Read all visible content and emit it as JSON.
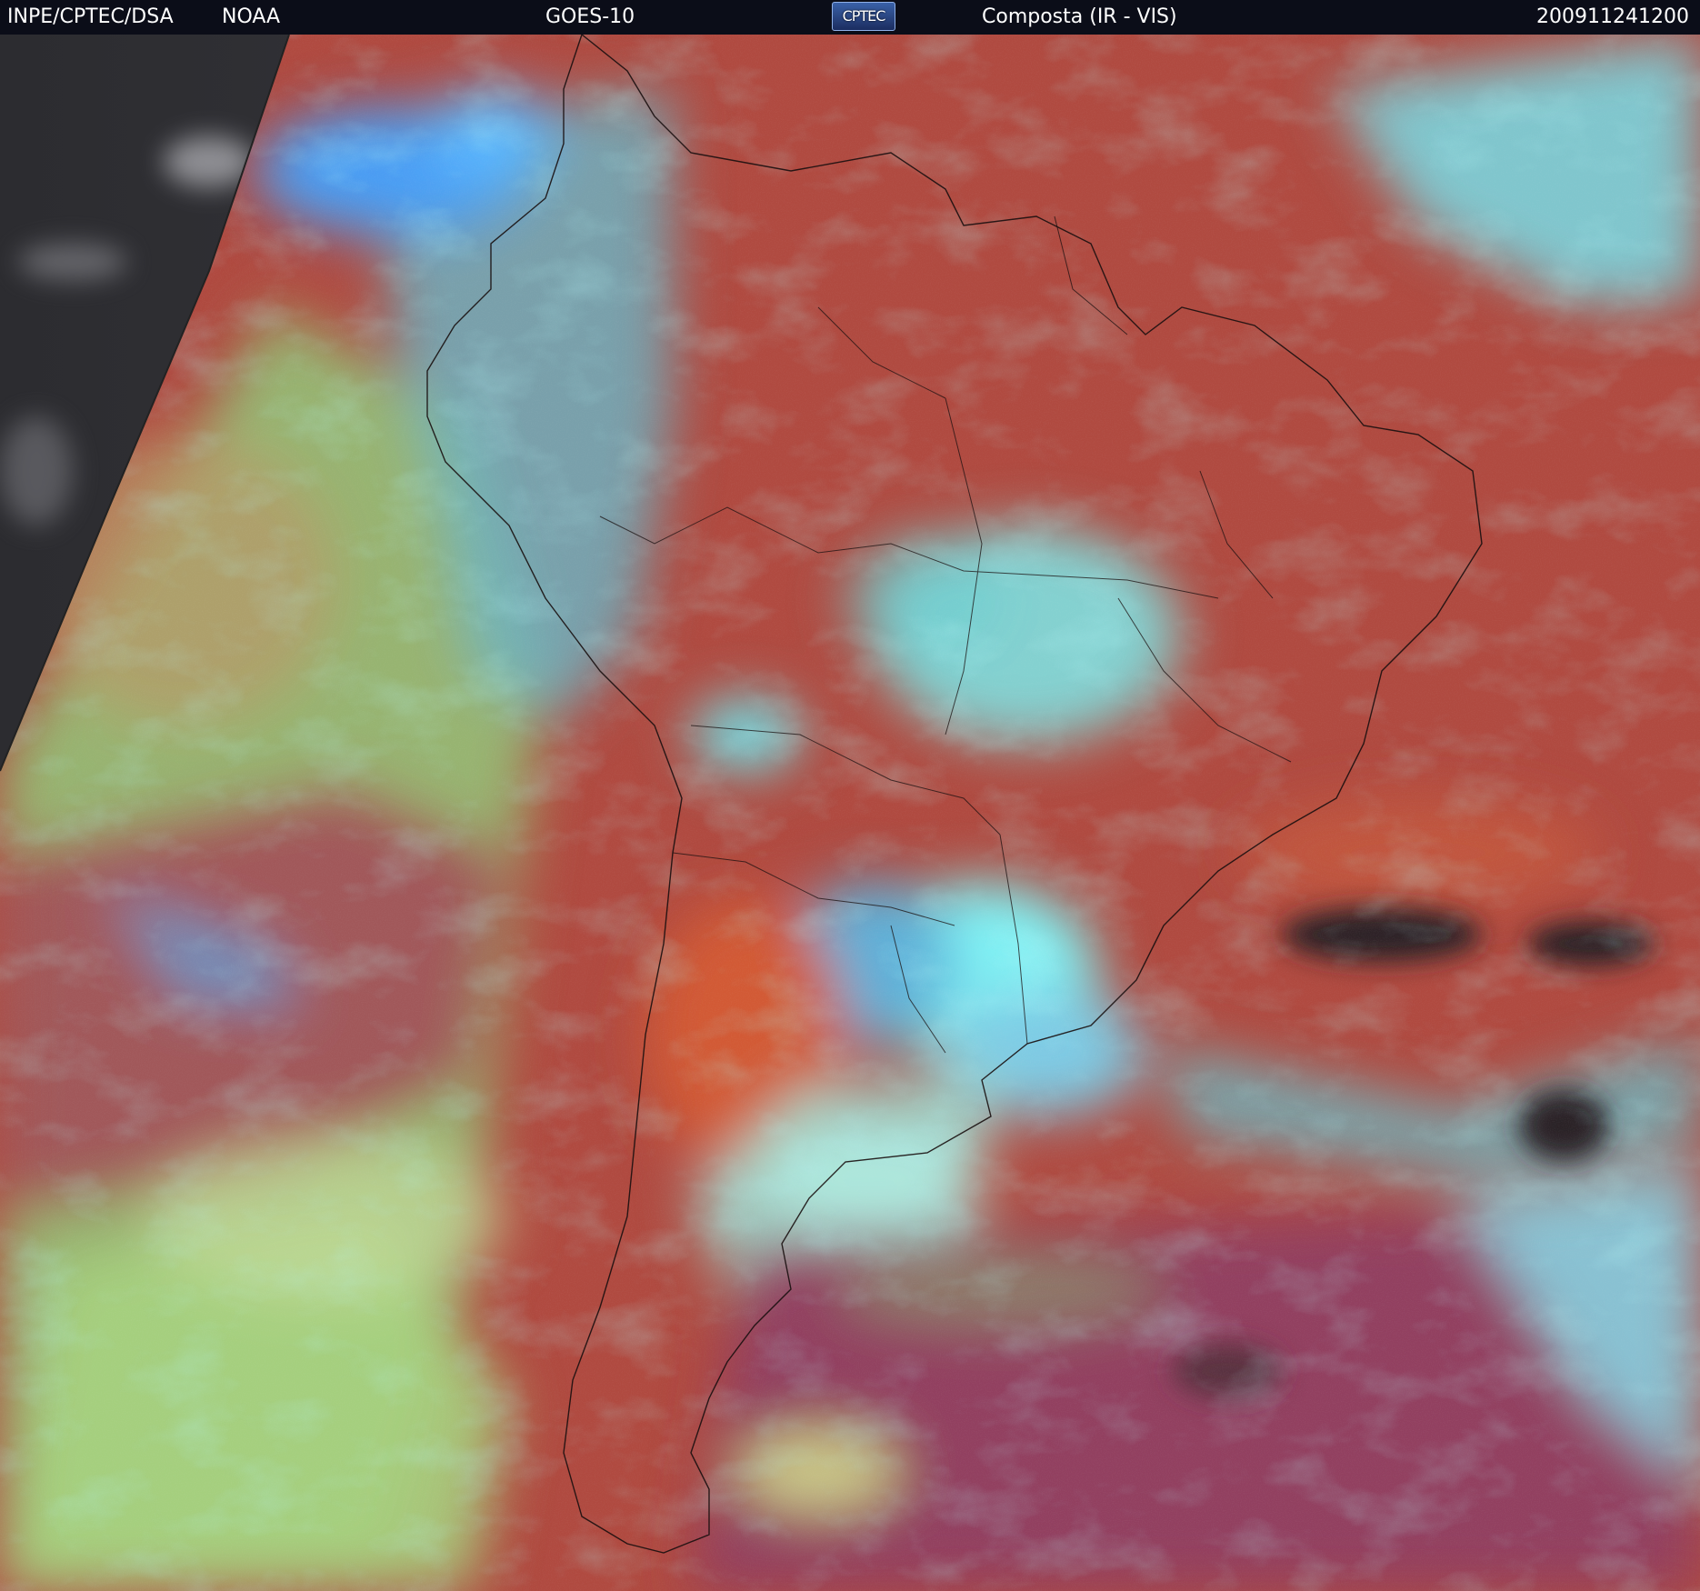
{
  "header": {
    "agency": "INPE/CPTEC/DSA",
    "provider": "NOAA",
    "satellite": "GOES-10",
    "logo_text": "CPTEC",
    "product": "Composta (IR - VIS)",
    "timestamp": "200911241200"
  },
  "imagery": {
    "icon": "satellite-composite-image",
    "colors": {
      "space": "#000000",
      "uncovered_left": "#3a3a3e",
      "clear_sky_red": "#b24a3e",
      "bright_red": "#cf4a30",
      "magenta_ocean": "#8e3e5e",
      "low_cloud_green": "#9ed07a",
      "high_cloud_cyan": "#72e6ea",
      "cold_top_blue": "#4aa0f0",
      "coast_line": "#1a1010"
    }
  }
}
